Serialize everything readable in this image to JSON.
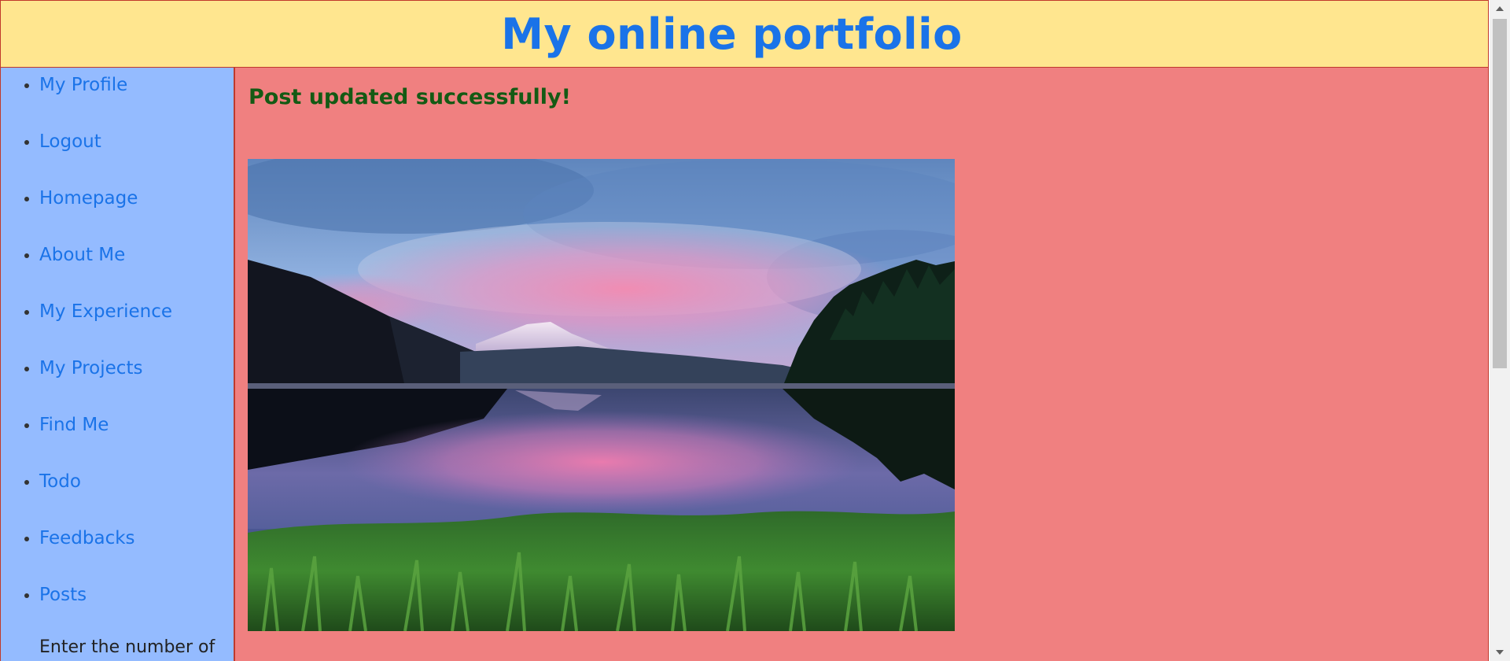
{
  "header": {
    "title": "My online portfolio"
  },
  "sidebar": {
    "items": [
      {
        "label": "My Profile"
      },
      {
        "label": "Logout"
      },
      {
        "label": "Homepage"
      },
      {
        "label": "About Me"
      },
      {
        "label": "My Experience"
      },
      {
        "label": "My Projects"
      },
      {
        "label": "Find Me"
      },
      {
        "label": "Todo"
      },
      {
        "label": "Feedbacks"
      },
      {
        "label": "Posts"
      }
    ],
    "note": "Enter the number of"
  },
  "main": {
    "status_message": "Post updated successfully!",
    "image": {
      "subject": "mountain-lake-sunset-photo"
    }
  },
  "colors": {
    "header_bg": "#ffe68f",
    "title": "#1a73e8",
    "sidebar_bg": "#94bbff",
    "main_bg": "#f08080",
    "border": "#c0392b",
    "success_text": "#145a14"
  }
}
